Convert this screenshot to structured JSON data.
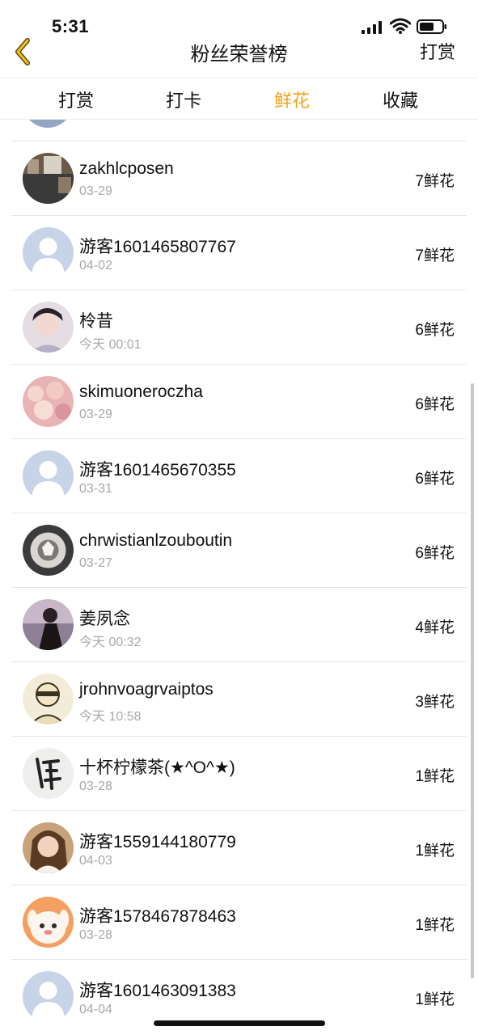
{
  "status_bar": {
    "time": "5:31",
    "icons": [
      "signal-icon",
      "wifi-icon",
      "battery-icon"
    ]
  },
  "nav": {
    "back_icon": "chevron-left-icon",
    "title": "粉丝荣誉榜",
    "right_action": "打赏"
  },
  "tabs": [
    {
      "label": "打赏",
      "active": false
    },
    {
      "label": "打卡",
      "active": false
    },
    {
      "label": "鲜花",
      "active": true
    },
    {
      "label": "收藏",
      "active": false
    }
  ],
  "colors": {
    "accent": "#f2a51a",
    "secondary_text": "#a9a9a9",
    "divider": "#e6e6e6"
  },
  "list": [
    {
      "name": "zakhlcposen",
      "date": "03-29",
      "count": "7鲜花",
      "avatar": "photo-avatar"
    },
    {
      "name": "游客1601465807767",
      "date": "04-02",
      "count": "7鲜花",
      "avatar": "default-user-avatar"
    },
    {
      "name": "柃昔",
      "date": "今天 00:01",
      "count": "6鲜花",
      "avatar": "photo-avatar"
    },
    {
      "name": "skimuoneroczha",
      "date": "03-29",
      "count": "6鲜花",
      "avatar": "photo-avatar"
    },
    {
      "name": "游客1601465670355",
      "date": "03-31",
      "count": "6鲜花",
      "avatar": "default-user-avatar"
    },
    {
      "name": "chrwistianlzouboutin",
      "date": "03-27",
      "count": "6鲜花",
      "avatar": "photo-avatar"
    },
    {
      "name": "姜夙念",
      "date": "今天 00:32",
      "count": "4鲜花",
      "avatar": "photo-avatar"
    },
    {
      "name": "jrohnvoagrvaiptos",
      "date": "今天 10:58",
      "count": "3鲜花",
      "avatar": "photo-avatar"
    },
    {
      "name": "十杯柠檬茶(★^O^★)",
      "date": "03-28",
      "count": "1鲜花",
      "avatar": "photo-avatar"
    },
    {
      "name": "游客1559144180779",
      "date": "04-03",
      "count": "1鲜花",
      "avatar": "photo-avatar"
    },
    {
      "name": "游客1578467878463",
      "date": "03-28",
      "count": "1鲜花",
      "avatar": "photo-avatar"
    },
    {
      "name": "游客1601463091383",
      "date": "04-04",
      "count": "1鲜花",
      "avatar": "default-user-avatar"
    }
  ]
}
